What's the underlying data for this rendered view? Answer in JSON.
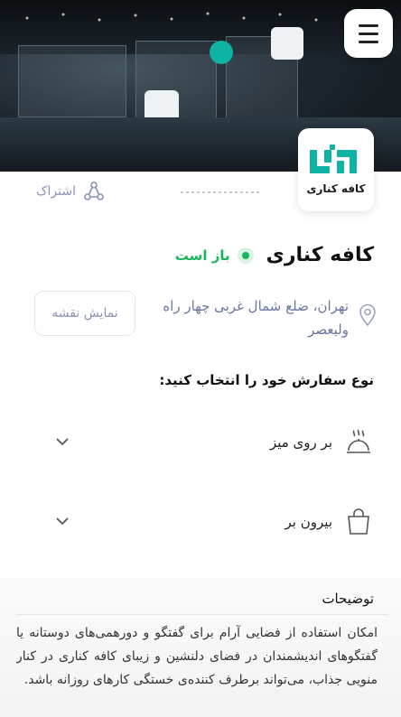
{
  "header": {
    "menu_icon": "hamburger-menu-icon"
  },
  "brand": {
    "logo_text": "کافه کناری",
    "accent_color": "#0fb3a4"
  },
  "share": {
    "label": "اشتراک",
    "icon": "share-icon"
  },
  "cafe": {
    "name": "کافه کناری",
    "status": "باز است",
    "status_color": "#18b55a",
    "address": "تهران، ضلع شمال غربی چهار راه ولیعصر",
    "map_button": "نمایش نقشه"
  },
  "order": {
    "heading": "نوع سفارش خود را انتخاب کنید:",
    "options": [
      {
        "label": "بر روی میز",
        "icon": "dish-icon"
      },
      {
        "label": "بیرون بر",
        "icon": "shopping-bag-icon"
      }
    ]
  },
  "description": {
    "title": "توضیحات",
    "text": "امکان استفاده از فضایی آرام برای گفتگو و دورهمی‌های دوستانه یا گفتگوهای اندیشمندان در فضای دلنشین و زیبای کافه کناری در کنار منویی جذاب، می‌تواند برطرف کننده‌ی خستگی کارهای روزانه باشد."
  }
}
